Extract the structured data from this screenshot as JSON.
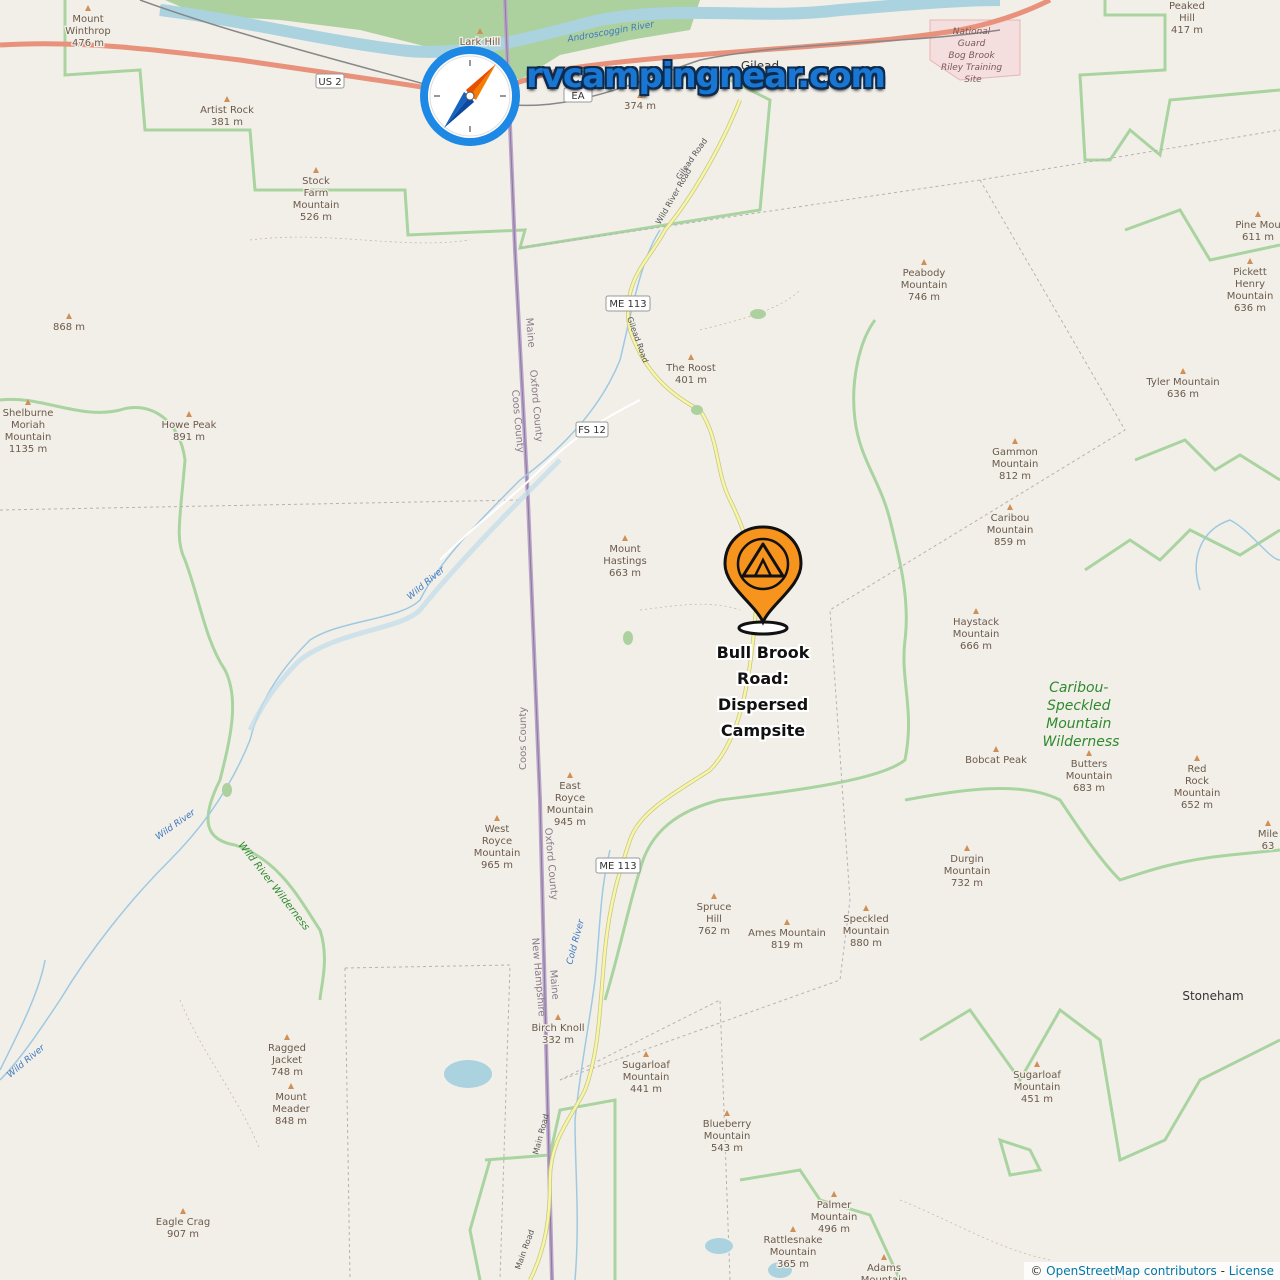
{
  "brand": {
    "text": "rvcampingnear.com",
    "icon": "compass-icon"
  },
  "campsite": {
    "name": "Bull Brook Road: Dispersed Campsite",
    "icon": "tent-pin-icon",
    "color": "#f7941d"
  },
  "attribution": {
    "prefix": "©",
    "link": "OpenStreetMap contributors",
    "sep": " - ",
    "license": "License"
  },
  "colors": {
    "land": "#f2efe9",
    "forest": "#add19e",
    "water": "#aad3df",
    "river": "#9ec9e2",
    "boundary": "#8fc28a",
    "road_yellow": "#f7f5a6",
    "road_major": "#e8927c",
    "accent": "#f7941d",
    "brand": "#1976d2"
  },
  "peaks": [
    {
      "name": "Mount Winthrop",
      "ele": "476 m"
    },
    {
      "name": "Artist Rock",
      "ele": "381 m"
    },
    {
      "name": "Stock Farm Mountain",
      "ele": "526 m"
    },
    {
      "name": "",
      "ele": "868 m"
    },
    {
      "name": "Shelburne Moriah Mountain",
      "ele": "1135 m"
    },
    {
      "name": "Howe Peak",
      "ele": "891 m"
    },
    {
      "name": "The Roost",
      "ele": "401 m"
    },
    {
      "name": "Peabody Mountain",
      "ele": "746 m"
    },
    {
      "name": "Peaked Hill",
      "ele": "417 m"
    },
    {
      "name": "Pine Mou",
      "ele": "611 m"
    },
    {
      "name": "Pickett Henry Mountain",
      "ele": "636 m"
    },
    {
      "name": "Tyler Mountain",
      "ele": "636 m"
    },
    {
      "name": "Gammon Mountain",
      "ele": "812 m"
    },
    {
      "name": "Caribou Mountain",
      "ele": "859 m"
    },
    {
      "name": "Mount Hastings",
      "ele": "663 m"
    },
    {
      "name": "Haystack Mountain",
      "ele": "666 m"
    },
    {
      "name": "Bobcat Peak",
      "ele": ""
    },
    {
      "name": "Butters Mountain",
      "ele": "683 m"
    },
    {
      "name": "Red Rock Mountain",
      "ele": "652 m"
    },
    {
      "name": "Mile",
      "ele": "63"
    },
    {
      "name": "East Royce Mountain",
      "ele": "945 m"
    },
    {
      "name": "West Royce Mountain",
      "ele": "965 m"
    },
    {
      "name": "Durgin Mountain",
      "ele": "732 m"
    },
    {
      "name": "Spruce Hill",
      "ele": "762 m"
    },
    {
      "name": "Ames Mountain",
      "ele": "819 m"
    },
    {
      "name": "Speckled Mountain",
      "ele": "880 m"
    },
    {
      "name": "Birch Knoll",
      "ele": "332 m"
    },
    {
      "name": "Ragged Jacket",
      "ele": "748 m"
    },
    {
      "name": "Mount Meader",
      "ele": "848 m"
    },
    {
      "name": "Sugarloaf Mountain",
      "ele": "441 m"
    },
    {
      "name": "Blueberry Mountain",
      "ele": "543 m"
    },
    {
      "name": "Sugarloaf Mountain",
      "ele": "451 m"
    },
    {
      "name": "Palmer Mountain",
      "ele": "496 m"
    },
    {
      "name": "Rattlesnake Mountain",
      "ele": "365 m"
    },
    {
      "name": "Adams Mountain",
      "ele": ""
    },
    {
      "name": "Eagle Crag",
      "ele": "907 m"
    },
    {
      "name": "Hill",
      "ele": ""
    },
    {
      "name": "Lark Hill",
      "ele": ""
    },
    {
      "name": "",
      "ele": "374 m"
    }
  ],
  "places": {
    "gilead": "Gilead",
    "stoneham": "Stoneham"
  },
  "wilderness": {
    "caribou": "Caribou-Speckled Mountain Wilderness",
    "wild_river": "Wild River Wilderness"
  },
  "rivers": {
    "wild_river": "Wild River",
    "androscoggin": "Androscoggin River",
    "cold_river": "Cold River"
  },
  "roads": {
    "us2": "US 2",
    "me113": "ME 113",
    "fs12": "FS 12",
    "gilead_road": "Gilead Road",
    "wild_river_road": "Wild River Road",
    "main_road": "Main Road",
    "ea": "EA"
  },
  "counties": {
    "maine": "Maine",
    "oxford": "Oxford County",
    "coos": "Coos County",
    "new_hampshire": "New Hampshire"
  },
  "military": {
    "name": "National Guard Bog Brook Riley Training Site"
  }
}
